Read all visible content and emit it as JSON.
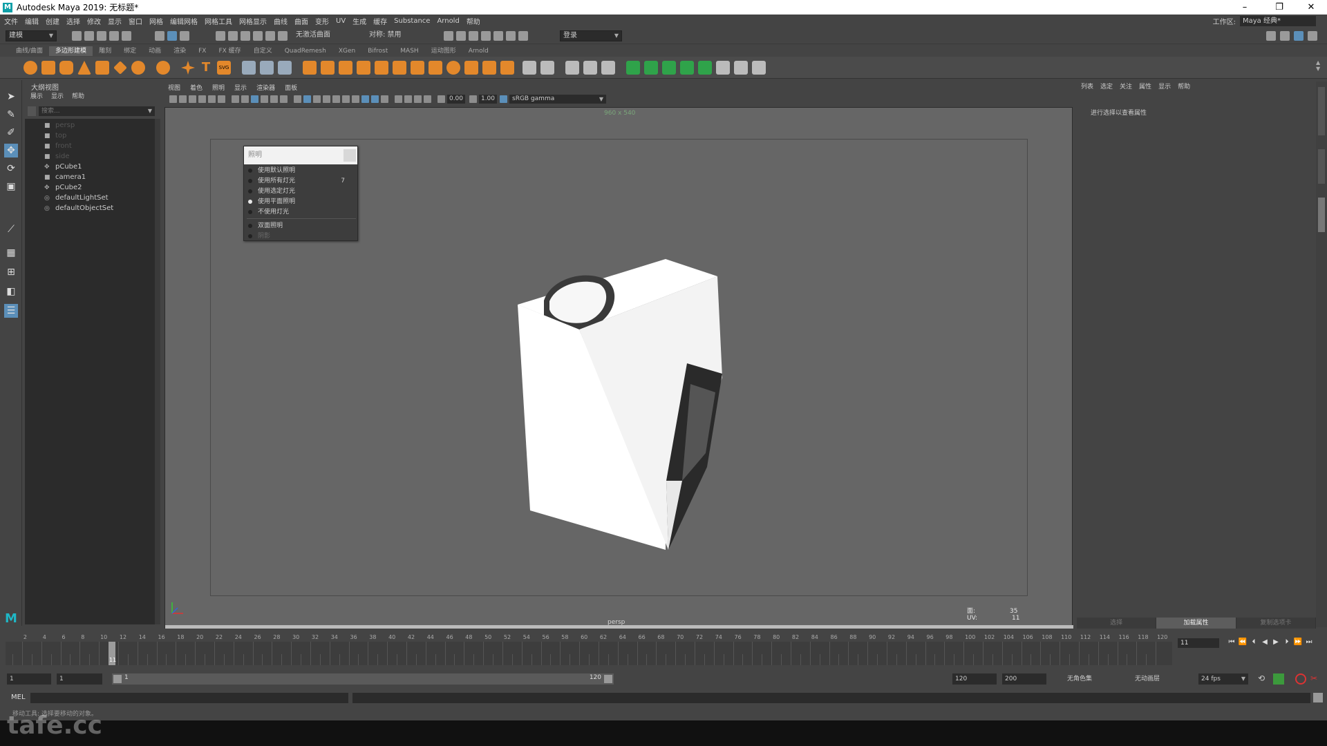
{
  "window": {
    "title": "Autodesk Maya 2019: 无标题*",
    "logo": "M"
  },
  "menubar": [
    "文件",
    "编辑",
    "创建",
    "选择",
    "修改",
    "显示",
    "窗口",
    "网格",
    "编辑网格",
    "网格工具",
    "网格显示",
    "曲线",
    "曲面",
    "变形",
    "UV",
    "生成",
    "缓存",
    "Substance",
    "Arnold",
    "帮助"
  ],
  "workspace": {
    "label": "工作区:",
    "value": "Maya 经典*"
  },
  "statusline": {
    "mode": "建模",
    "live_surface": "无激活曲面",
    "symmetry": "对称: 禁用",
    "login": "登录"
  },
  "shelf_tabs": [
    "曲线/曲面",
    "多边形建模",
    "雕刻",
    "绑定",
    "动画",
    "渲染",
    "FX",
    "FX 缓存",
    "自定义",
    "QuadRemesh",
    "XGen",
    "Bifrost",
    "MASH",
    "运动图形",
    "Arnold"
  ],
  "shelf_active_tab": "多边形建模",
  "shelf_text_icons": [
    "T",
    "SVG"
  ],
  "outliner": {
    "title": "大纲视图",
    "menu": [
      "展示",
      "显示",
      "帮助"
    ],
    "search_placeholder": "搜索...",
    "items": [
      {
        "label": "persp",
        "icon": "camera-icon",
        "dim": true
      },
      {
        "label": "top",
        "icon": "camera-icon",
        "dim": true
      },
      {
        "label": "front",
        "icon": "camera-icon",
        "dim": true
      },
      {
        "label": "side",
        "icon": "camera-icon",
        "dim": true
      },
      {
        "label": "pCube1",
        "icon": "transform-icon",
        "dim": false
      },
      {
        "label": "camera1",
        "icon": "camera-icon",
        "dim": false
      },
      {
        "label": "pCube2",
        "icon": "transform-icon",
        "dim": false
      },
      {
        "label": "defaultLightSet",
        "icon": "set-icon",
        "dim": false
      },
      {
        "label": "defaultObjectSet",
        "icon": "set-icon",
        "dim": false
      }
    ]
  },
  "viewport": {
    "menu": [
      "视图",
      "着色",
      "照明",
      "显示",
      "渲染器",
      "面板"
    ],
    "exposure": "0.00",
    "gamma": "1.00",
    "colorspace": "sRGB gamma",
    "resolution": "960 x 540",
    "camera": "persp",
    "hud": [
      {
        "label": "面:",
        "value": "35"
      },
      {
        "label": "UV:",
        "value": "11"
      }
    ]
  },
  "lighting_popup": {
    "title": "照明",
    "items": [
      {
        "label": "使用默认照明",
        "selected": false,
        "key": "",
        "dim": false
      },
      {
        "label": "使用所有灯光",
        "selected": false,
        "key": "7",
        "dim": false
      },
      {
        "label": "使用选定灯光",
        "selected": false,
        "key": "",
        "dim": false
      },
      {
        "label": "使用平面照明",
        "selected": true,
        "key": "",
        "dim": false
      },
      {
        "label": "不使用灯光",
        "selected": false,
        "key": "",
        "dim": false
      },
      {
        "label": "双面照明",
        "selected": false,
        "key": "",
        "dim": false
      },
      {
        "label": "阴影",
        "selected": false,
        "key": "",
        "dim": true
      }
    ]
  },
  "attribute_editor": {
    "menu": [
      "列表",
      "选定",
      "关注",
      "属性",
      "显示",
      "帮助"
    ],
    "hint": "进行选择以查看属性",
    "tabs": [
      "选择",
      "加载属性",
      "复制选项卡"
    ],
    "active_tab": "加载属性"
  },
  "timeslider": {
    "labels": [
      "2",
      "4",
      "6",
      "8",
      "10",
      "12",
      "14",
      "16",
      "18",
      "20",
      "22",
      "24",
      "26",
      "28",
      "30",
      "32",
      "34",
      "36",
      "38",
      "40",
      "42",
      "44",
      "46",
      "48",
      "50",
      "52",
      "54",
      "56",
      "58",
      "60",
      "62",
      "64",
      "66",
      "68",
      "70",
      "72",
      "74",
      "76",
      "78",
      "80",
      "82",
      "84",
      "86",
      "88",
      "90",
      "92",
      "94",
      "96",
      "98",
      "100",
      "102",
      "104",
      "106",
      "108",
      "110",
      "112",
      "114",
      "116",
      "118",
      "120"
    ],
    "current_frame": "11",
    "current_field": "11"
  },
  "range": {
    "start": "1",
    "start2": "1",
    "handle_start": "1",
    "handle_end": "120",
    "end": "120",
    "end2": "200",
    "character_set": "无角色集",
    "anim_layer": "无动画层",
    "fps": "24 fps"
  },
  "cmdline": {
    "label": "MEL"
  },
  "helpline": {
    "text": "移动工具: 选择要移动的对象。"
  },
  "watermark": "tafe.cc"
}
